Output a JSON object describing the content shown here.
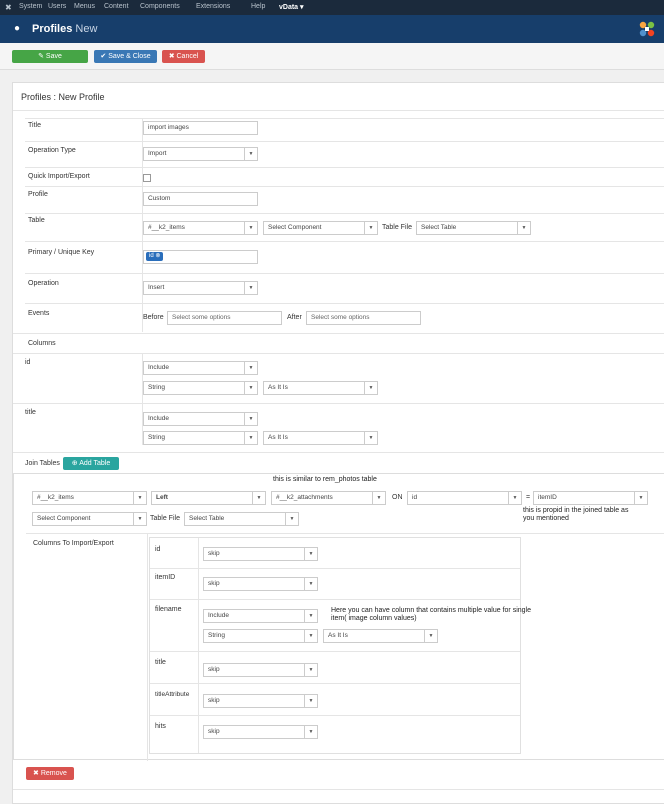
{
  "topmenu": [
    "System",
    "Users",
    "Menus",
    "Content",
    "Components",
    "Extensions",
    "Help",
    "vData"
  ],
  "header": {
    "title": "Profiles",
    "title_suffix": "New"
  },
  "toolbar": {
    "save": "Save",
    "save_close": "Save & Close",
    "cancel": "Cancel"
  },
  "panel_title": "Profiles : New Profile",
  "form": {
    "title_label": "Title",
    "title_value": "import images",
    "optype_label": "Operation Type",
    "optype_value": "Import",
    "quick_label": "Quick Import/Export",
    "profile_label": "Profile",
    "profile_value": "Custom",
    "table_label": "Table",
    "table_value": "#__k2_items",
    "component_value": "Select Component",
    "tablefile_label": "Table File",
    "tablefile_value": "Select Table",
    "pk_label": "Primary / Unique Key",
    "pk_tag": "id",
    "operation_label": "Operation",
    "operation_value": "Insert",
    "events_label": "Events",
    "before_label": "Before",
    "before_placeholder": "Select some options",
    "after_label": "After",
    "after_placeholder": "Select some options",
    "columns_label": "Columns"
  },
  "columns": [
    {
      "name": "id",
      "mode": "Include",
      "type": "String",
      "format": "As It Is"
    },
    {
      "name": "title",
      "mode": "Include",
      "type": "String",
      "format": "As It Is"
    }
  ],
  "join": {
    "label": "Join Tables",
    "add_button": "Add Table",
    "table": "#__k2_items",
    "jointype": "Left",
    "join_table": "#__k2_attachments",
    "on_label": "ON",
    "on_left": "id",
    "eq": "=",
    "on_right": "itemID",
    "component": "Select Component",
    "tablefile_label": "Table File",
    "tablefile": "Select Table",
    "columns_label": "Columns To Import/Export",
    "cols": [
      {
        "name": "id",
        "mode": "skip"
      },
      {
        "name": "itemID",
        "mode": "skip"
      },
      {
        "name": "filename",
        "mode": "Include",
        "type": "String",
        "format": "As It Is"
      },
      {
        "name": "title",
        "mode": "skip"
      },
      {
        "name": "titleAttribute",
        "mode": "skip"
      },
      {
        "name": "hits",
        "mode": "skip"
      }
    ],
    "remove_button": "Remove"
  },
  "notes": {
    "n1": "this is similar to rem_photos table",
    "n2": "this is propid in the joined table as you mentioned",
    "n3": "Here you can have column that contains multiple value for single item( image column values)"
  }
}
